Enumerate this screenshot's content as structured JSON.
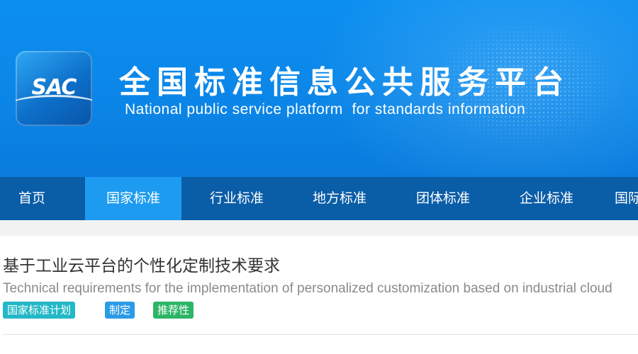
{
  "header": {
    "logo_text": "SAC",
    "title_cn": "全国标准信息公共服务平台",
    "title_en": "National public service platform  for standards information"
  },
  "nav": {
    "items": [
      {
        "label": "首页",
        "active": false
      },
      {
        "label": "国家标准",
        "active": true
      },
      {
        "label": "行业标准",
        "active": false
      },
      {
        "label": "地方标准",
        "active": false
      },
      {
        "label": "团体标准",
        "active": false
      },
      {
        "label": "企业标准",
        "active": false
      },
      {
        "label": "国际",
        "active": false
      }
    ]
  },
  "standard": {
    "title": "基于工业云平台的个性化定制技术要求",
    "title_en": "Technical requirements for the implementation of personalized customization based on industrial cloud",
    "tags": [
      {
        "label": "国家标准计划",
        "color": "#23b8c7"
      },
      {
        "label": "制定",
        "color": "#2c9be6"
      },
      {
        "label": "推荐性",
        "color": "#2db566"
      }
    ]
  },
  "colors": {
    "banner": "#0b88ea",
    "nav_bg": "#0a5da7",
    "nav_active": "#1d9bf0"
  }
}
